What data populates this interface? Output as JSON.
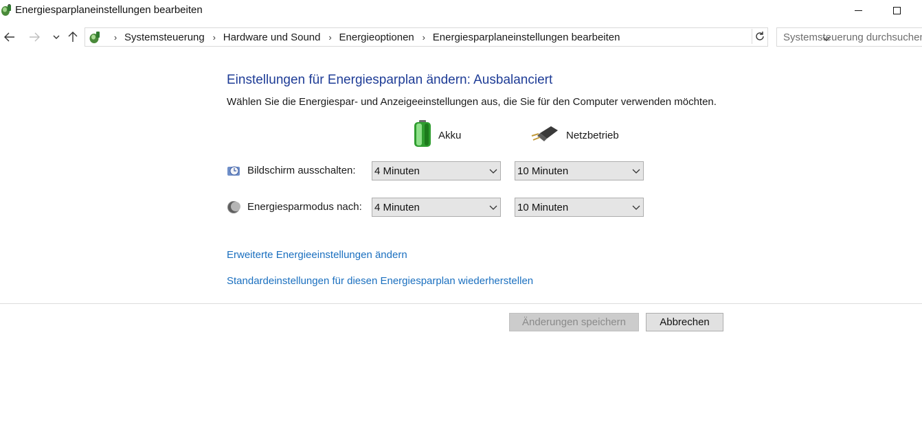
{
  "window": {
    "title": "Energiesparplaneinstellungen bearbeiten"
  },
  "nav": {
    "breadcrumbs": [
      {
        "label": "Systemsteuerung"
      },
      {
        "label": "Hardware und Sound"
      },
      {
        "label": "Energieoptionen"
      },
      {
        "label": "Energiesparplaneinstellungen bearbeiten"
      }
    ],
    "search_placeholder": "Systemsteuerung durchsuchen"
  },
  "main": {
    "title": "Einstellungen für Energiesparplan ändern: Ausbalanciert",
    "description": "Wählen Sie die Energiespar- und Anzeigeeinstellungen aus, die Sie für den Computer verwenden möchten.",
    "columns": {
      "battery": "Akku",
      "plugged_in": "Netzbetrieb"
    },
    "settings": [
      {
        "label": "Bildschirm ausschalten:",
        "battery": "4 Minuten",
        "plugged_in": "10 Minuten"
      },
      {
        "label": "Energiesparmodus nach:",
        "battery": "4 Minuten",
        "plugged_in": "10 Minuten"
      }
    ],
    "links": {
      "advanced": "Erweiterte Energieeinstellungen ändern",
      "restore": "Standardeinstellungen für diesen Energiesparplan wiederherstellen"
    }
  },
  "buttons": {
    "save": "Änderungen speichern",
    "cancel": "Abbrechen"
  },
  "colors": {
    "title_blue": "#1e3c96",
    "link_blue": "#1a6fbf",
    "battery_green": "#3cb43c"
  }
}
